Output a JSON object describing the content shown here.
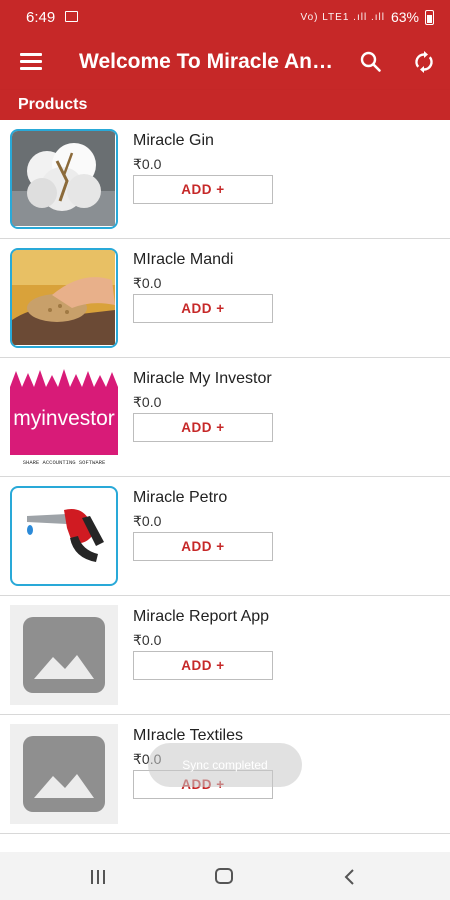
{
  "status_bar": {
    "time": "6:49",
    "signal_text": "Vo) LTE1 .ıll .ıll",
    "battery": "63%"
  },
  "app_bar": {
    "title": "Welcome To Miracle Android Ap",
    "menu_icon": "hamburger-menu-icon",
    "search_icon": "search-icon",
    "sync_icon": "sync-icon"
  },
  "section": {
    "title": "Products"
  },
  "products": [
    {
      "name": "Miracle Gin",
      "price": "₹0.0",
      "add_label": "ADD +",
      "image": "cotton-photo"
    },
    {
      "name": "MIracle Mandi",
      "price": "₹0.0",
      "add_label": "ADD +",
      "image": "grain-hand-photo"
    },
    {
      "name": "Miracle My Investor",
      "price": "₹0.0",
      "add_label": "ADD +",
      "image": "myinvestor-logo",
      "logo_text": "myinvestor",
      "logo_subtext": "SHARE ACCOUNTING SOFTWARE"
    },
    {
      "name": "Miracle Petro",
      "price": "₹0.0",
      "add_label": "ADD +",
      "image": "fuel-nozzle-icon"
    },
    {
      "name": "Miracle Report App",
      "price": "₹0.0",
      "add_label": "ADD +",
      "image": "image-placeholder-icon"
    },
    {
      "name": "MIracle Textiles",
      "price": "₹0.0",
      "add_label": "ADD +",
      "image": "image-placeholder-icon"
    }
  ],
  "toast": {
    "text": "Sync completed"
  },
  "colors": {
    "primary": "#c62828",
    "thumb_border": "#29a9d8",
    "add_text": "#c62828"
  }
}
